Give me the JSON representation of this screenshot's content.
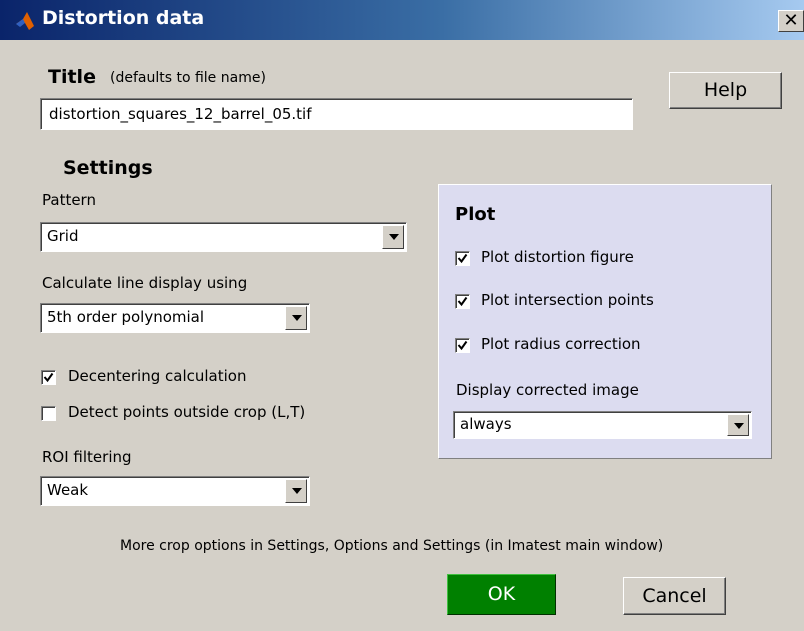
{
  "window": {
    "title": "Distortion data",
    "close_glyph": "✕",
    "icon": "matlab-icon"
  },
  "title_section": {
    "heading": "Title",
    "hint": "(defaults to file name)",
    "value": "distortion_squares_12_barrel_05.tif"
  },
  "help_button": "Help",
  "settings": {
    "heading": "Settings",
    "pattern_label": "Pattern",
    "pattern_value": "Grid",
    "calc_label": "Calculate line display using",
    "calc_value": "5th order polynomial",
    "decentering_label": "Decentering calculation",
    "decentering_checked": true,
    "detect_outside_label": "Detect points outside crop (L,T)",
    "detect_outside_checked": false,
    "roi_label": "ROI filtering",
    "roi_value": "Weak"
  },
  "plot": {
    "heading": "Plot",
    "items": [
      {
        "label": "Plot distortion figure",
        "checked": true
      },
      {
        "label": "Plot intersection points",
        "checked": true
      },
      {
        "label": "Plot radius correction",
        "checked": true
      }
    ],
    "display_label": "Display corrected image",
    "display_value": "always",
    "panel_color": "#dcdcf0"
  },
  "footer_note": "More crop options in Settings, Options and Settings (in Imatest main window)",
  "ok_button": "OK",
  "cancel_button": "Cancel",
  "colors": {
    "ok_green": "#008000",
    "titlebar_dark": "#0a246a",
    "titlebar_light": "#a6caf0"
  }
}
